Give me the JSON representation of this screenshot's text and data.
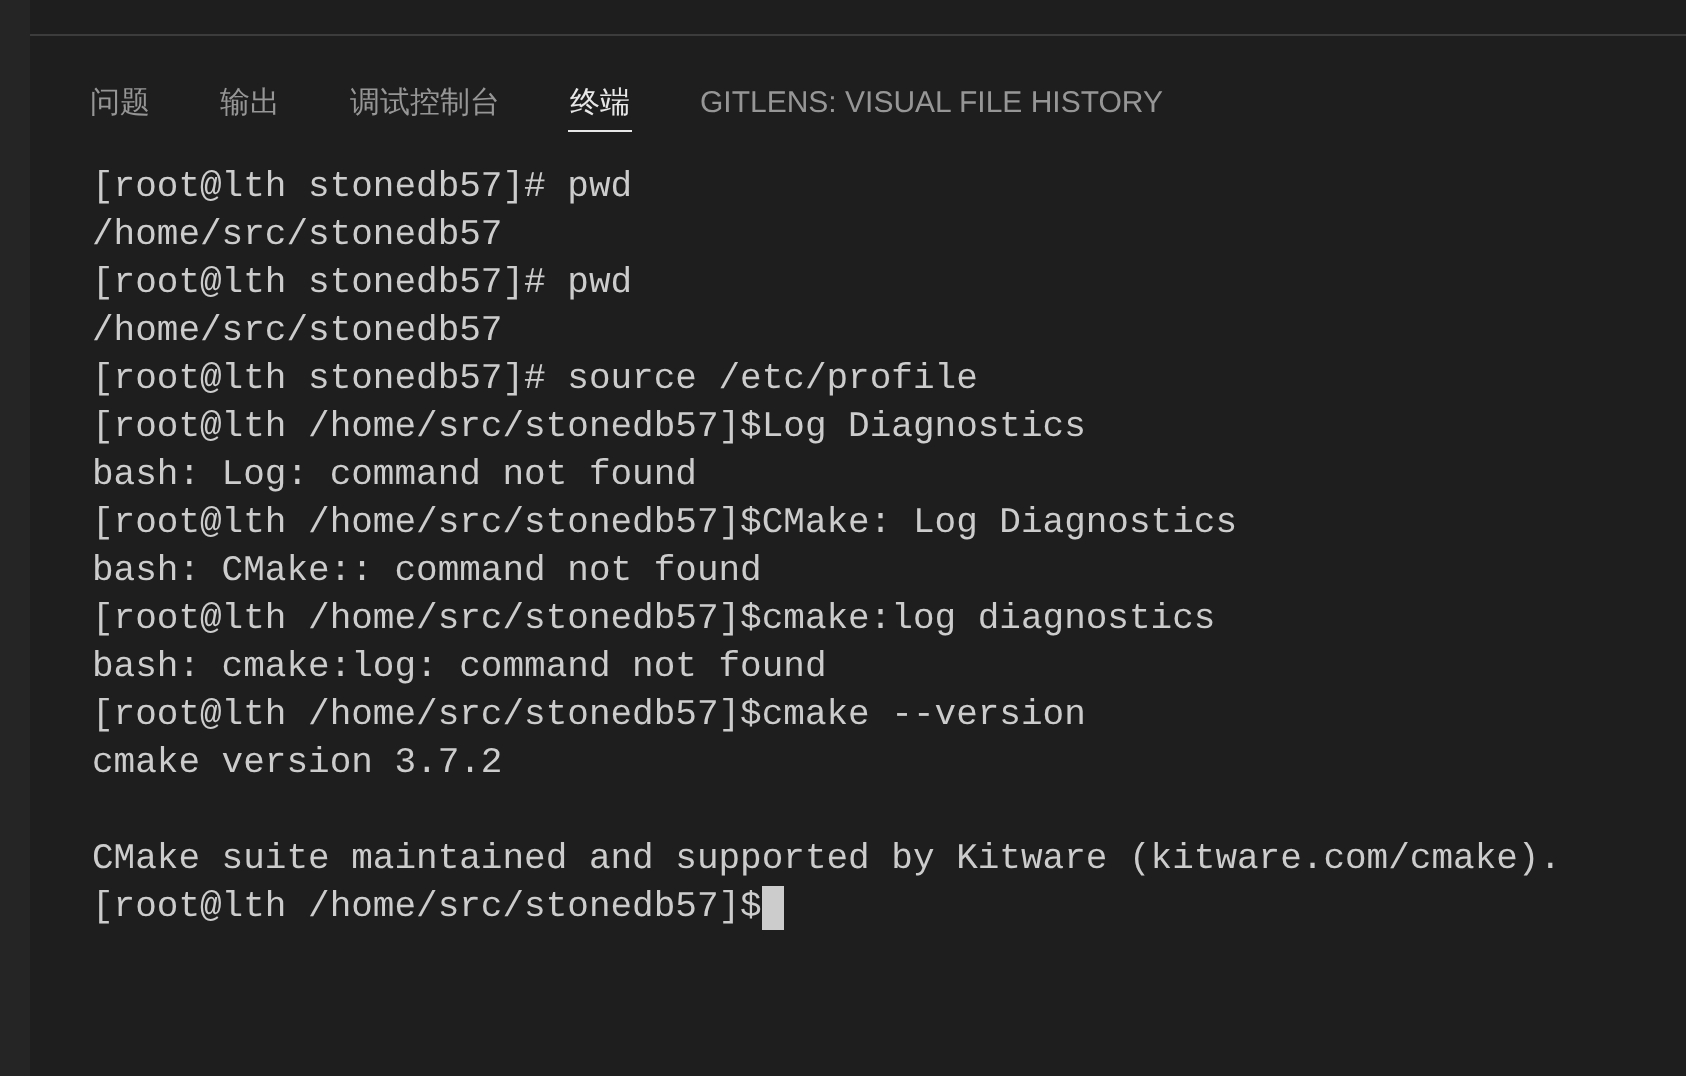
{
  "tabs": [
    {
      "label": "问题",
      "selected": false
    },
    {
      "label": "输出",
      "selected": false
    },
    {
      "label": "调试控制台",
      "selected": false
    },
    {
      "label": "终端",
      "selected": true
    },
    {
      "label": "GITLENS: VISUAL FILE HISTORY",
      "selected": false
    }
  ],
  "terminal": {
    "lines": [
      {
        "kind": "text",
        "text": "[root@lth stonedb57]# pwd"
      },
      {
        "kind": "text",
        "text": "/home/src/stonedb57"
      },
      {
        "kind": "text",
        "text": "[root@lth stonedb57]# pwd"
      },
      {
        "kind": "text",
        "text": "/home/src/stonedb57"
      },
      {
        "kind": "text",
        "text": "[root@lth stonedb57]# source /etc/profile"
      },
      {
        "kind": "text",
        "text": "[root@lth /home/src/stonedb57]$Log Diagnostics"
      },
      {
        "kind": "text",
        "text": "bash: Log: command not found"
      },
      {
        "kind": "text",
        "text": "[root@lth /home/src/stonedb57]$CMake: Log Diagnostics"
      },
      {
        "kind": "text",
        "text": "bash: CMake:: command not found"
      },
      {
        "kind": "text",
        "text": "[root@lth /home/src/stonedb57]$cmake:log diagnostics"
      },
      {
        "kind": "text",
        "text": "bash: cmake:log: command not found"
      },
      {
        "kind": "text",
        "text": "[root@lth /home/src/stonedb57]$cmake --version"
      },
      {
        "kind": "text",
        "text": "cmake version 3.7.2"
      },
      {
        "kind": "blank"
      },
      {
        "kind": "text",
        "text": "CMake suite maintained and supported by Kitware (kitware.com/cmake)."
      },
      {
        "kind": "prompt",
        "text": "[root@lth /home/src/stonedb57]$",
        "cursor": true
      }
    ]
  }
}
